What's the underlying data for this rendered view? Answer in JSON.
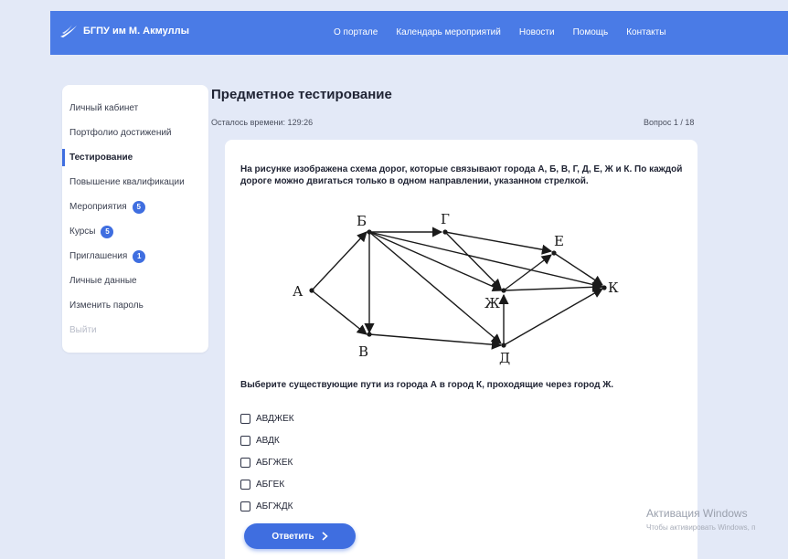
{
  "header": {
    "brand": "БГПУ им М. Акмуллы",
    "nav": [
      "О портале",
      "Календарь мероприятий",
      "Новости",
      "Помощь",
      "Контакты"
    ]
  },
  "sidebar": {
    "items": [
      {
        "label": "Личный кабинет"
      },
      {
        "label": "Портфолио достижений"
      },
      {
        "label": "Тестирование",
        "active": true
      },
      {
        "label": "Повышение квалификации"
      },
      {
        "label": "Мероприятия",
        "badge": "5"
      },
      {
        "label": "Курсы",
        "badge": "5"
      },
      {
        "label": "Приглашения",
        "badge": "1"
      },
      {
        "label": "Личные данные"
      },
      {
        "label": "Изменить пароль"
      },
      {
        "label": "Выйти",
        "disabled": true
      }
    ]
  },
  "main": {
    "title": "Предметное тестирование",
    "timer": "Осталось времени: 129:26",
    "question_number": "Вопрос 1 / 18",
    "question_text": "На рисунке изображена схема дорог, которые связывают города А, Б, В, Г, Д, Е, Ж и К. По каждой дороге можно двигаться только в одном направлении, указанном стрелкой.",
    "graph_nodes": {
      "A": "А",
      "B": "Б",
      "V": "В",
      "G": "Г",
      "D": "Д",
      "E": "Е",
      "Zh": "Ж",
      "K": "К"
    },
    "task": "Выберите существующие пути из города А в город К, проходящие через город Ж.",
    "options": [
      "АВДЖЕК",
      "АВДК",
      "АБГЖЕК",
      "АБГЕК",
      "АБГЖДК"
    ],
    "submit_label": "Ответить"
  },
  "watermark": {
    "title": "Активация Windows",
    "subtitle": "Чтобы активировать Windows, п"
  },
  "colors": {
    "accent": "#3f6ee0",
    "header": "#4a7be6",
    "background": "#e3e9f7"
  }
}
